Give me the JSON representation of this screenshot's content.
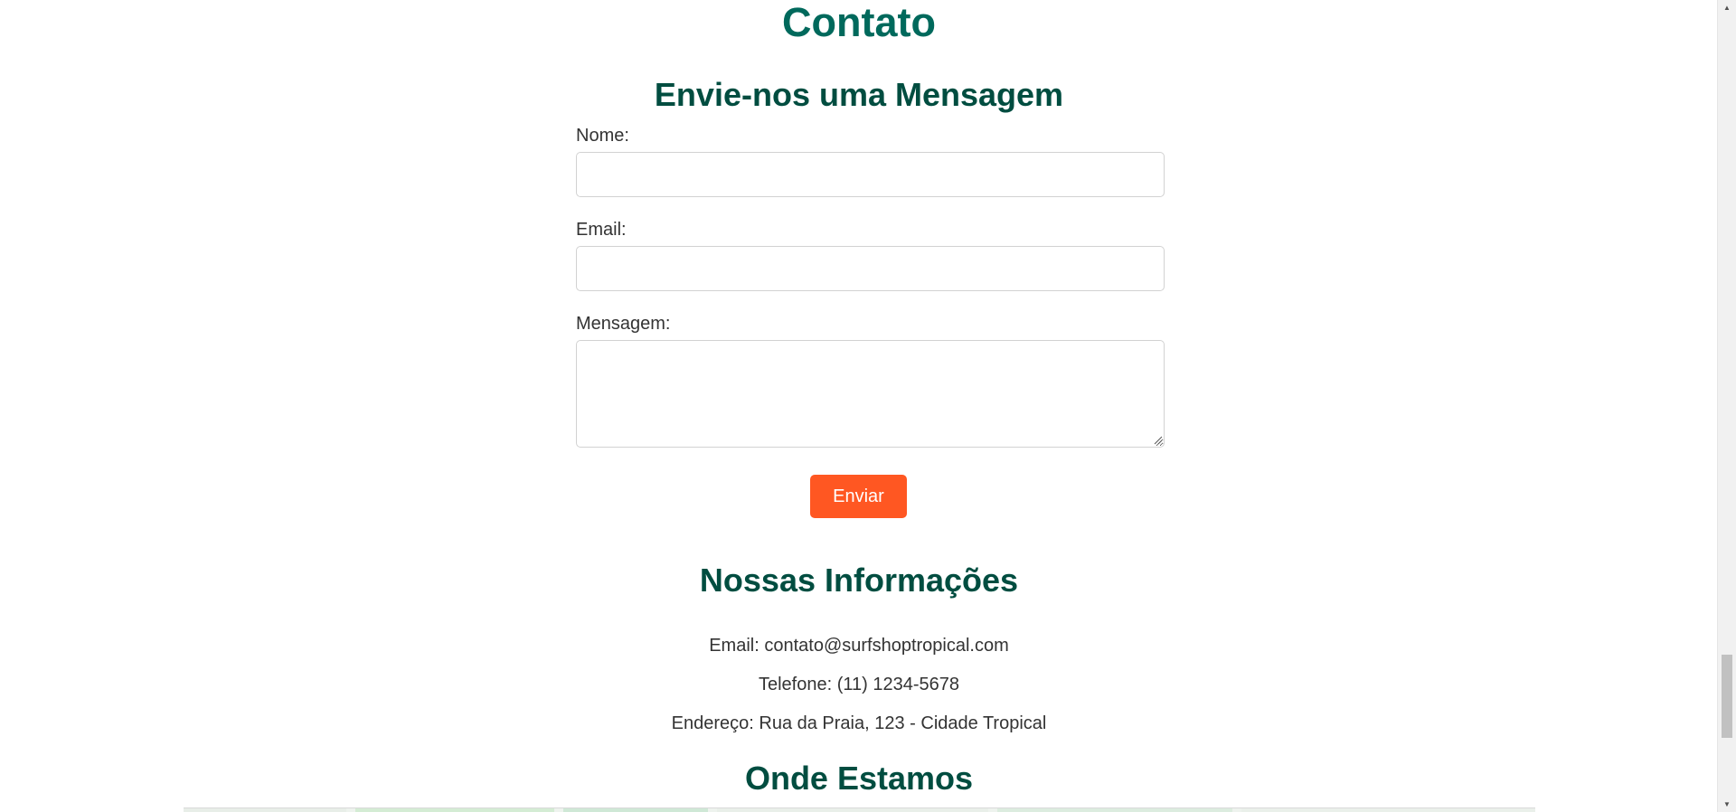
{
  "contact": {
    "title": "Contato"
  },
  "form": {
    "title": "Envie-nos uma Mensagem",
    "name_label": "Nome:",
    "name_value": "",
    "email_label": "Email:",
    "email_value": "",
    "message_label": "Mensagem:",
    "message_value": "",
    "submit_label": "Enviar"
  },
  "info": {
    "title": "Nossas Informações",
    "email": "Email: contato@surfshoptropical.com",
    "phone": "Telefone: (11) 1234-5678",
    "address": "Endereço: Rua da Praia, 123 - Cidade Tropical"
  },
  "map": {
    "title": "Onde Estamos"
  },
  "colors": {
    "title": "#00695c",
    "subtitle": "#004d40",
    "button": "#ff5722",
    "text": "#333333"
  }
}
